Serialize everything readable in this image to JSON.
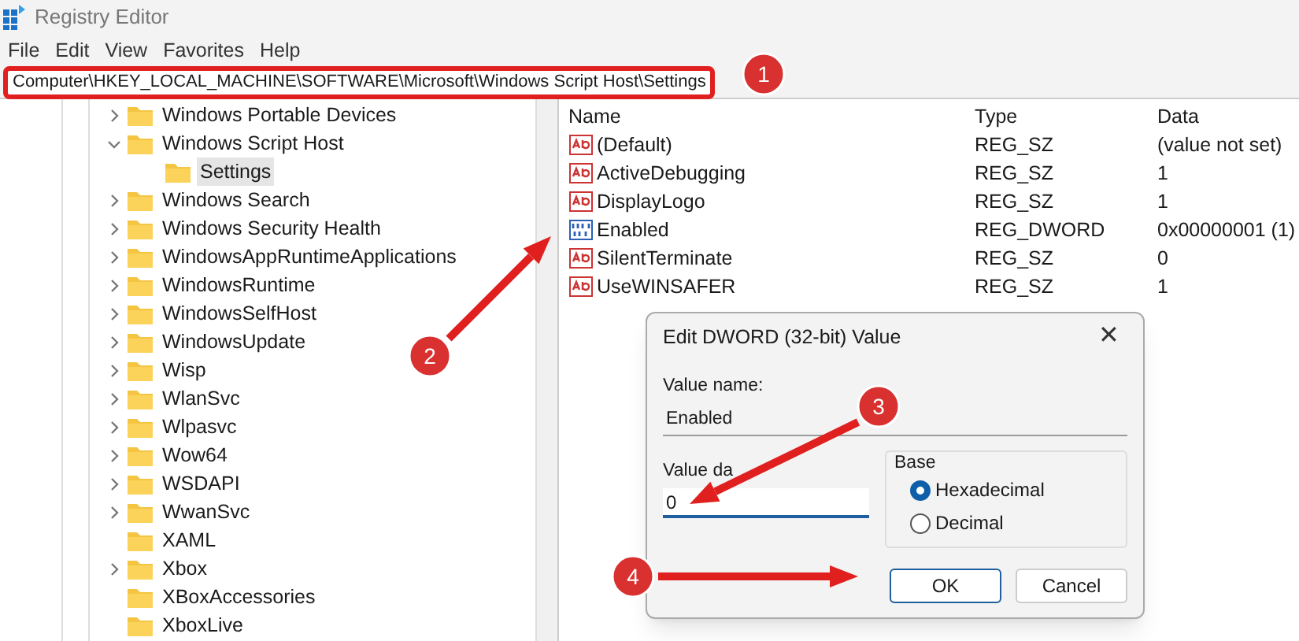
{
  "window": {
    "title": "Registry Editor"
  },
  "menu": [
    "File",
    "Edit",
    "View",
    "Favorites",
    "Help"
  ],
  "address": "Computer\\HKEY_LOCAL_MACHINE\\SOFTWARE\\Microsoft\\Windows Script Host\\Settings",
  "tree": [
    {
      "label": "Windows Portable Devices",
      "expanded": false,
      "selected": false
    },
    {
      "label": "Windows Script Host",
      "expanded": true,
      "selected": false,
      "children": [
        {
          "label": "Settings",
          "selected": true
        }
      ]
    },
    {
      "label": "Windows Search",
      "expanded": false,
      "selected": false
    },
    {
      "label": "Windows Security Health",
      "expanded": false,
      "selected": false
    },
    {
      "label": "WindowsAppRuntimeApplications",
      "expanded": false,
      "selected": false
    },
    {
      "label": "WindowsRuntime",
      "expanded": false,
      "selected": false
    },
    {
      "label": "WindowsSelfHost",
      "expanded": false,
      "selected": false
    },
    {
      "label": "WindowsUpdate",
      "expanded": false,
      "selected": false
    },
    {
      "label": "Wisp",
      "expanded": false,
      "selected": false
    },
    {
      "label": "WlanSvc",
      "expanded": false,
      "selected": false
    },
    {
      "label": "Wlpasvc",
      "expanded": false,
      "selected": false
    },
    {
      "label": "Wow64",
      "expanded": false,
      "selected": false
    },
    {
      "label": "WSDAPI",
      "expanded": false,
      "selected": false
    },
    {
      "label": "WwanSvc",
      "expanded": false,
      "selected": false
    },
    {
      "label": "XAML",
      "selected": false
    },
    {
      "label": "Xbox",
      "expanded": false,
      "selected": false
    },
    {
      "label": "XBoxAccessories",
      "selected": false
    },
    {
      "label": "XboxLive",
      "selected": false
    }
  ],
  "values": {
    "columns": [
      "Name",
      "Type",
      "Data"
    ],
    "rows": [
      {
        "kind": "string",
        "name": "(Default)",
        "type": "REG_SZ",
        "data": "(value not set)"
      },
      {
        "kind": "string",
        "name": "ActiveDebugging",
        "type": "REG_SZ",
        "data": "1"
      },
      {
        "kind": "string",
        "name": "DisplayLogo",
        "type": "REG_SZ",
        "data": "1"
      },
      {
        "kind": "binary",
        "name": "Enabled",
        "type": "REG_DWORD",
        "data": "0x00000001 (1)"
      },
      {
        "kind": "string",
        "name": "SilentTerminate",
        "type": "REG_SZ",
        "data": "0"
      },
      {
        "kind": "string",
        "name": "UseWINSAFER",
        "type": "REG_SZ",
        "data": "1"
      }
    ]
  },
  "dialog": {
    "title": "Edit DWORD (32-bit) Value",
    "close": "✕",
    "value_name_label": "Value name:",
    "value_name": "Enabled",
    "value_data_label": "Value da",
    "value_data": "0",
    "base_label": "Base",
    "base_options": [
      {
        "label": "Hexadecimal",
        "selected": true
      },
      {
        "label": "Decimal",
        "selected": false
      }
    ],
    "buttons": [
      "OK",
      "Cancel"
    ]
  },
  "annotations": [
    {
      "label": "1"
    },
    {
      "label": "2"
    },
    {
      "label": "3"
    },
    {
      "label": "4"
    }
  ]
}
